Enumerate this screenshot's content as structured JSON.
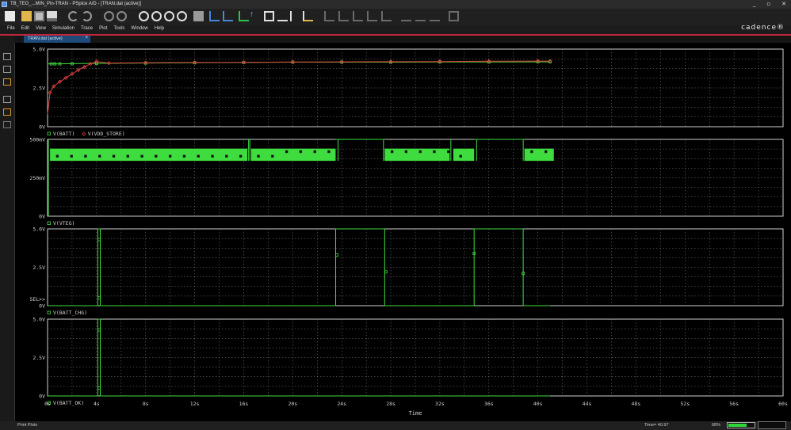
{
  "window": {
    "title": "TB_TEG_...MIN_Pin-TRAN - PSpice A/D  - [TRAN.dat (active)]",
    "controls": [
      "_",
      "▫",
      "✕"
    ]
  },
  "menu": {
    "items": [
      "File",
      "Edit",
      "View",
      "Simulation",
      "Trace",
      "Plot",
      "Tools",
      "Window",
      "Help"
    ],
    "logo": "cadence®"
  },
  "tab": {
    "label": "TRAN.dat (active)",
    "close": "×"
  },
  "status": {
    "message": "Print Plots",
    "time": "Time= 40.97",
    "percent": "68%",
    "progress": 0.68
  },
  "chart_data": {
    "type": "line",
    "xlabel": "Time",
    "xlim": [
      0,
      60
    ],
    "xticks": [
      "0s",
      "4s",
      "8s",
      "12s",
      "16s",
      "20s",
      "24s",
      "28s",
      "32s",
      "36s",
      "40s",
      "44s",
      "48s",
      "52s",
      "56s",
      "60s"
    ],
    "cursor_label": "SEL>>",
    "colors": {
      "green": "#3fdc3f",
      "red": "#e04040",
      "grid": "#808080",
      "axis": "#d0d0d0"
    },
    "plots": [
      {
        "yticks": [
          "5.0V",
          "2.5V",
          "0V"
        ],
        "ylim": [
          0,
          5
        ],
        "legend": [
          "V(BATT)",
          "V(VDD_STORE)"
        ],
        "series": [
          {
            "name": "V(BATT)",
            "color": "#3fdc3f",
            "marker": "square",
            "x": [
              0,
              0.3,
              0.6,
              1,
              2,
              4,
              8,
              12,
              16,
              20,
              24,
              28,
              32,
              36,
              40,
              41
            ],
            "y": [
              4.05,
              4.05,
              4.05,
              4.05,
              4.06,
              4.08,
              4.1,
              4.12,
              4.14,
              4.16,
              4.16,
              4.16,
              4.17,
              4.17,
              4.18,
              4.18
            ]
          },
          {
            "name": "V(VDD_STORE)",
            "color": "#e04040",
            "marker": "diamond",
            "x": [
              0,
              0.2,
              0.5,
              1,
              1.5,
              2,
              2.5,
              3,
              3.5,
              4,
              5,
              8,
              12,
              16,
              20,
              24,
              28,
              32,
              36,
              40,
              41
            ],
            "y": [
              0.8,
              2.2,
              2.6,
              2.9,
              3.15,
              3.4,
              3.65,
              3.85,
              4.05,
              4.2,
              4.1,
              4.12,
              4.14,
              4.15,
              4.17,
              4.18,
              4.19,
              4.2,
              4.22,
              4.23,
              4.23
            ]
          }
        ]
      },
      {
        "yticks": [
          "500mV",
          "250mV",
          "0V"
        ],
        "ylim": [
          0,
          0.5
        ],
        "legend": [
          "V(VTEG)"
        ],
        "series": [
          {
            "name": "V(VTEG)",
            "color": "#3fdc3f",
            "marker": "square",
            "bands": [
              [
                0.2,
                16.3,
                0.36,
                0.44
              ],
              [
                16.6,
                23.5,
                0.36,
                0.44
              ],
              [
                27.5,
                32.8,
                0.36,
                0.44
              ],
              [
                33.1,
                34.8,
                0.36,
                0.44
              ],
              [
                38.9,
                41.3,
                0.36,
                0.44
              ]
            ],
            "spikes": [
              16.4,
              16.5,
              23.7,
              27.4,
              32.9,
              35.0,
              38.8
            ],
            "ymax": 0.5
          }
        ]
      },
      {
        "yticks": [
          "5.0V",
          "2.5V",
          "0V"
        ],
        "ylim": [
          0,
          5
        ],
        "legend": [
          "V(BATT_CHG)"
        ],
        "series": [
          {
            "name": "V(BATT_CHG)",
            "color": "#3fdc3f",
            "marker": "square",
            "x": [
              0,
              4.1,
              4.1,
              4.3,
              4.3,
              23.5,
              23.5,
              27.5,
              27.5,
              34.8,
              34.8,
              38.8,
              38.8,
              41
            ],
            "y": [
              0,
              0,
              5,
              5,
              0,
              0,
              5,
              5,
              0,
              0,
              5,
              5,
              0,
              0
            ],
            "markers": [
              [
                4.2,
                4.3
              ],
              [
                4.2,
                0.5
              ],
              [
                23.6,
                3.3
              ],
              [
                27.6,
                2.2
              ],
              [
                34.8,
                3.4
              ],
              [
                38.8,
                2.1
              ]
            ]
          }
        ]
      },
      {
        "yticks": [
          "5.0V",
          "2.5V",
          "0V"
        ],
        "ylim": [
          0,
          5
        ],
        "legend": [
          "V(BATT_OK)"
        ],
        "series": [
          {
            "name": "V(BATT_OK)",
            "color": "#3fdc3f",
            "marker": "square",
            "x": [
              0,
              4.1,
              4.1,
              4.3,
              4.3,
              41
            ],
            "y": [
              0,
              0,
              5,
              5,
              0,
              0
            ],
            "markers": [
              [
                4.2,
                4.3
              ],
              [
                4.2,
                0.5
              ]
            ]
          }
        ]
      }
    ]
  }
}
